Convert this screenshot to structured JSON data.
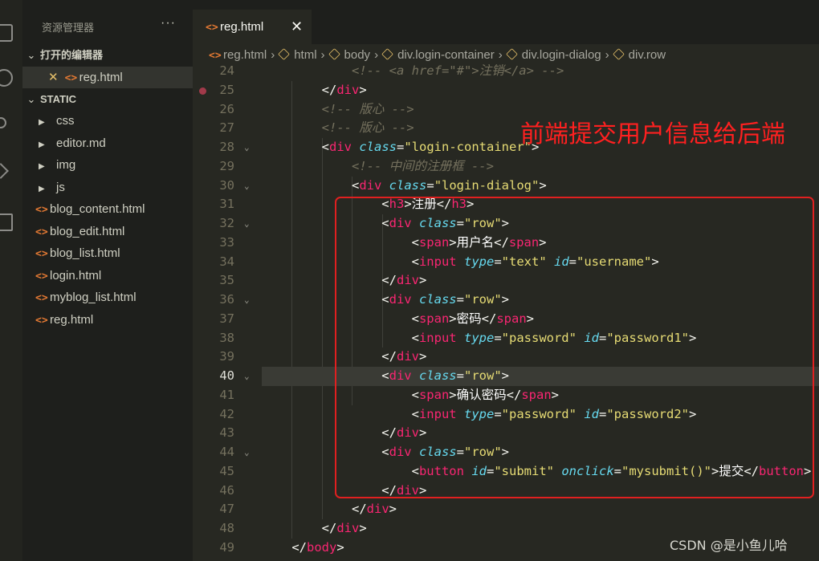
{
  "explorer": {
    "title": "资源管理器",
    "more": "···",
    "open_editors_label": "打开的编辑器",
    "open_editor_file": "reg.html",
    "folder_label": "STATIC",
    "folders": [
      "css",
      "editor.md",
      "img",
      "js"
    ],
    "files": [
      "blog_content.html",
      "blog_edit.html",
      "blog_list.html",
      "login.html",
      "myblog_list.html",
      "reg.html"
    ]
  },
  "tab": {
    "label": "reg.html",
    "close": "✕"
  },
  "breadcrumb": {
    "file": "reg.html",
    "items": [
      "html",
      "body",
      "div.login-container",
      "div.login-dialog",
      "div.row"
    ]
  },
  "code_lines": [
    {
      "n": "24",
      "t": [
        [
          "c-cm",
          "            <!-- <a href=\"#\">注销</a> -->"
        ]
      ]
    },
    {
      "n": "25",
      "t": [
        [
          "c-pl",
          "        </"
        ],
        [
          "c-tag",
          "div"
        ],
        [
          "c-pl",
          ">"
        ]
      ]
    },
    {
      "n": "26",
      "t": [
        [
          "c-cm",
          "        <!-- 版心 -->"
        ]
      ]
    },
    {
      "n": "27",
      "t": [
        [
          "c-cm",
          "        <!-- 版心 -->"
        ]
      ]
    },
    {
      "n": "28",
      "t": [
        [
          "c-pl",
          "        <"
        ],
        [
          "c-tag",
          "div"
        ],
        [
          "c-pl",
          " "
        ],
        [
          "c-attr",
          "class"
        ],
        [
          "c-pl",
          "="
        ],
        [
          "c-str",
          "\"login-container\""
        ],
        [
          "c-pl",
          ">"
        ]
      ]
    },
    {
      "n": "29",
      "t": [
        [
          "c-cm",
          "            <!-- 中间的注册框 -->"
        ]
      ]
    },
    {
      "n": "30",
      "t": [
        [
          "c-pl",
          "            <"
        ],
        [
          "c-tag",
          "div"
        ],
        [
          "c-pl",
          " "
        ],
        [
          "c-attr",
          "class"
        ],
        [
          "c-pl",
          "="
        ],
        [
          "c-str",
          "\"login-dialog\""
        ],
        [
          "c-pl",
          ">"
        ]
      ]
    },
    {
      "n": "31",
      "t": [
        [
          "c-pl",
          "                <"
        ],
        [
          "c-tag",
          "h3"
        ],
        [
          "c-pl",
          ">"
        ],
        [
          "c-cjk",
          "注册"
        ],
        [
          "c-pl",
          "</"
        ],
        [
          "c-tag",
          "h3"
        ],
        [
          "c-pl",
          ">"
        ]
      ]
    },
    {
      "n": "32",
      "t": [
        [
          "c-pl",
          "                <"
        ],
        [
          "c-tag",
          "div"
        ],
        [
          "c-pl",
          " "
        ],
        [
          "c-attr",
          "class"
        ],
        [
          "c-pl",
          "="
        ],
        [
          "c-str",
          "\"row\""
        ],
        [
          "c-pl",
          ">"
        ]
      ]
    },
    {
      "n": "33",
      "t": [
        [
          "c-pl",
          "                    <"
        ],
        [
          "c-tag",
          "span"
        ],
        [
          "c-pl",
          ">"
        ],
        [
          "c-cjk",
          "用户名"
        ],
        [
          "c-pl",
          "</"
        ],
        [
          "c-tag",
          "span"
        ],
        [
          "c-pl",
          ">"
        ]
      ]
    },
    {
      "n": "34",
      "t": [
        [
          "c-pl",
          "                    <"
        ],
        [
          "c-tag",
          "input"
        ],
        [
          "c-pl",
          " "
        ],
        [
          "c-attr",
          "type"
        ],
        [
          "c-pl",
          "="
        ],
        [
          "c-str",
          "\"text\""
        ],
        [
          "c-pl",
          " "
        ],
        [
          "c-attr",
          "id"
        ],
        [
          "c-pl",
          "="
        ],
        [
          "c-str",
          "\"username\""
        ],
        [
          "c-pl",
          ">"
        ]
      ]
    },
    {
      "n": "35",
      "t": [
        [
          "c-pl",
          "                </"
        ],
        [
          "c-tag",
          "div"
        ],
        [
          "c-pl",
          ">"
        ]
      ]
    },
    {
      "n": "36",
      "t": [
        [
          "c-pl",
          "                <"
        ],
        [
          "c-tag",
          "div"
        ],
        [
          "c-pl",
          " "
        ],
        [
          "c-attr",
          "class"
        ],
        [
          "c-pl",
          "="
        ],
        [
          "c-str",
          "\"row\""
        ],
        [
          "c-pl",
          ">"
        ]
      ]
    },
    {
      "n": "37",
      "t": [
        [
          "c-pl",
          "                    <"
        ],
        [
          "c-tag",
          "span"
        ],
        [
          "c-pl",
          ">"
        ],
        [
          "c-cjk",
          "密码"
        ],
        [
          "c-pl",
          "</"
        ],
        [
          "c-tag",
          "span"
        ],
        [
          "c-pl",
          ">"
        ]
      ]
    },
    {
      "n": "38",
      "t": [
        [
          "c-pl",
          "                    <"
        ],
        [
          "c-tag",
          "input"
        ],
        [
          "c-pl",
          " "
        ],
        [
          "c-attr",
          "type"
        ],
        [
          "c-pl",
          "="
        ],
        [
          "c-str",
          "\"password\""
        ],
        [
          "c-pl",
          " "
        ],
        [
          "c-attr",
          "id"
        ],
        [
          "c-pl",
          "="
        ],
        [
          "c-str",
          "\"password1\""
        ],
        [
          "c-pl",
          ">"
        ]
      ]
    },
    {
      "n": "39",
      "t": [
        [
          "c-pl",
          "                </"
        ],
        [
          "c-tag",
          "div"
        ],
        [
          "c-pl",
          ">"
        ]
      ]
    },
    {
      "n": "40",
      "t": [
        [
          "c-pl",
          "                <"
        ],
        [
          "c-tag",
          "div"
        ],
        [
          "c-pl",
          " "
        ],
        [
          "c-attr",
          "class"
        ],
        [
          "c-pl",
          "="
        ],
        [
          "c-str",
          "\"row\""
        ],
        [
          "c-pl",
          ">"
        ]
      ]
    },
    {
      "n": "41",
      "t": [
        [
          "c-pl",
          "                    <"
        ],
        [
          "c-tag",
          "span"
        ],
        [
          "c-pl",
          ">"
        ],
        [
          "c-cjk",
          "确认密码"
        ],
        [
          "c-pl",
          "</"
        ],
        [
          "c-tag",
          "span"
        ],
        [
          "c-pl",
          ">"
        ]
      ]
    },
    {
      "n": "42",
      "t": [
        [
          "c-pl",
          "                    <"
        ],
        [
          "c-tag",
          "input"
        ],
        [
          "c-pl",
          " "
        ],
        [
          "c-attr",
          "type"
        ],
        [
          "c-pl",
          "="
        ],
        [
          "c-str",
          "\"password\""
        ],
        [
          "c-pl",
          " "
        ],
        [
          "c-attr",
          "id"
        ],
        [
          "c-pl",
          "="
        ],
        [
          "c-str",
          "\"password2\""
        ],
        [
          "c-pl",
          ">"
        ]
      ]
    },
    {
      "n": "43",
      "t": [
        [
          "c-pl",
          "                </"
        ],
        [
          "c-tag",
          "div"
        ],
        [
          "c-pl",
          ">"
        ]
      ]
    },
    {
      "n": "44",
      "t": [
        [
          "c-pl",
          "                <"
        ],
        [
          "c-tag",
          "div"
        ],
        [
          "c-pl",
          " "
        ],
        [
          "c-attr",
          "class"
        ],
        [
          "c-pl",
          "="
        ],
        [
          "c-str",
          "\"row\""
        ],
        [
          "c-pl",
          ">"
        ]
      ]
    },
    {
      "n": "45",
      "t": [
        [
          "c-pl",
          "                    <"
        ],
        [
          "c-tag",
          "button"
        ],
        [
          "c-pl",
          " "
        ],
        [
          "c-attr",
          "id"
        ],
        [
          "c-pl",
          "="
        ],
        [
          "c-str",
          "\"submit\""
        ],
        [
          "c-pl",
          " "
        ],
        [
          "c-attr",
          "onclick"
        ],
        [
          "c-pl",
          "="
        ],
        [
          "c-str",
          "\"mysubmit()\""
        ],
        [
          "c-pl",
          ">"
        ],
        [
          "c-cjk",
          "提交"
        ],
        [
          "c-pl",
          "</"
        ],
        [
          "c-tag",
          "button"
        ],
        [
          "c-pl",
          ">"
        ]
      ]
    },
    {
      "n": "46",
      "t": [
        [
          "c-pl",
          "                </"
        ],
        [
          "c-tag",
          "div"
        ],
        [
          "c-pl",
          ">"
        ]
      ]
    },
    {
      "n": "47",
      "t": [
        [
          "c-pl",
          "            </"
        ],
        [
          "c-tag",
          "div"
        ],
        [
          "c-pl",
          ">"
        ]
      ]
    },
    {
      "n": "48",
      "t": [
        [
          "c-pl",
          "        </"
        ],
        [
          "c-tag",
          "div"
        ],
        [
          "c-pl",
          ">"
        ]
      ]
    },
    {
      "n": "49",
      "t": [
        [
          "c-pl",
          "    </"
        ],
        [
          "c-tag",
          "body"
        ],
        [
          "c-pl",
          ">"
        ]
      ]
    }
  ],
  "current_line": "40",
  "breakpoint_line": "25",
  "fold_lines": [
    "28",
    "30",
    "32",
    "36",
    "40",
    "44"
  ],
  "annotation": "前端提交用户信息给后端",
  "watermark": "CSDN @是小鱼儿哈",
  "colors": {
    "annotation": "#ff2020",
    "tag": "#f92672",
    "attribute": "#66d9ef",
    "string": "#e6db74",
    "comment": "#75715e"
  }
}
